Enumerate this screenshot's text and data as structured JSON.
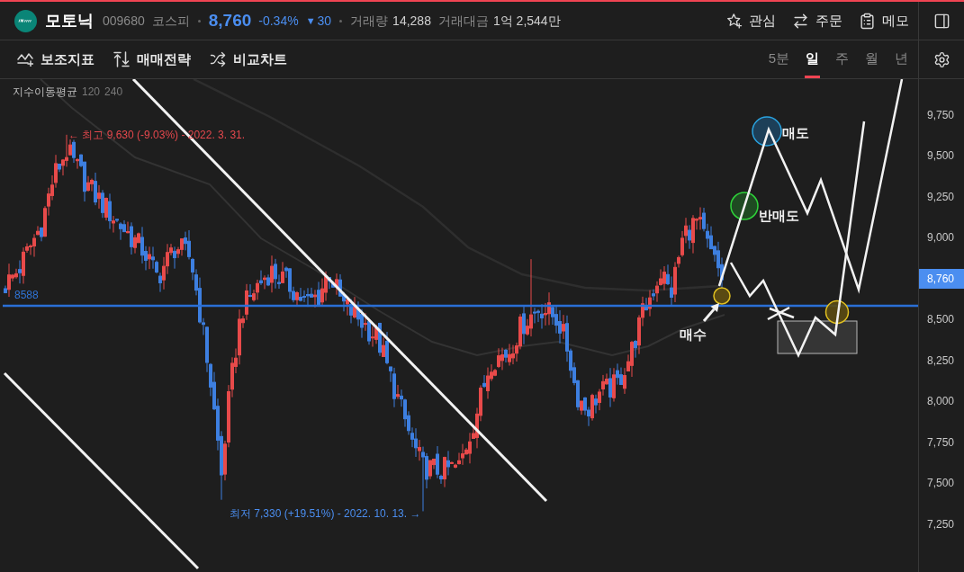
{
  "header": {
    "name": "모토닉",
    "code": "009680",
    "market": "코스피",
    "price": "8,760",
    "change_rate": "-0.34%",
    "change_arrow": "▼",
    "change": "30",
    "volume_label": "거래량",
    "volume": "14,288",
    "amount_label": "거래대금",
    "amount": "1억 2,544만"
  },
  "header_actions": [
    {
      "kind": "star",
      "label": "관심"
    },
    {
      "kind": "order",
      "label": "주문"
    },
    {
      "kind": "memo",
      "label": "메모"
    }
  ],
  "toolbar": [
    {
      "kind": "indicator",
      "label": "보조지표"
    },
    {
      "kind": "strategy",
      "label": "매매전략"
    },
    {
      "kind": "compare",
      "label": "비교차트"
    }
  ],
  "periods": [
    {
      "label": "5분",
      "selected": false
    },
    {
      "label": "일",
      "selected": true
    },
    {
      "label": "주",
      "selected": false
    },
    {
      "label": "월",
      "selected": false
    },
    {
      "label": "년",
      "selected": false
    }
  ],
  "chart": {
    "legend_title": "지수이동평균",
    "legend_periods": [
      "120",
      "240"
    ],
    "high_label": "← 최고 9,630 (-9.03%) - 2022. 3. 31.",
    "low_label": "최저 7,330 (+19.51%) - 2022. 10. 13. →",
    "support_label": "8588",
    "annotations": [
      {
        "kind": "sell",
        "label": "매도"
      },
      {
        "kind": "half_sell",
        "label": "반매도"
      },
      {
        "kind": "buy",
        "label": "매수"
      }
    ]
  },
  "price_axis": {
    "upper_ticks": [
      "9,750",
      "9,500",
      "9,250",
      "9,000"
    ],
    "current_price": "8,760",
    "lower_ticks": [
      "8,500",
      "8,250",
      "8,000",
      "7,750",
      "7,500",
      "7,250"
    ]
  }
}
